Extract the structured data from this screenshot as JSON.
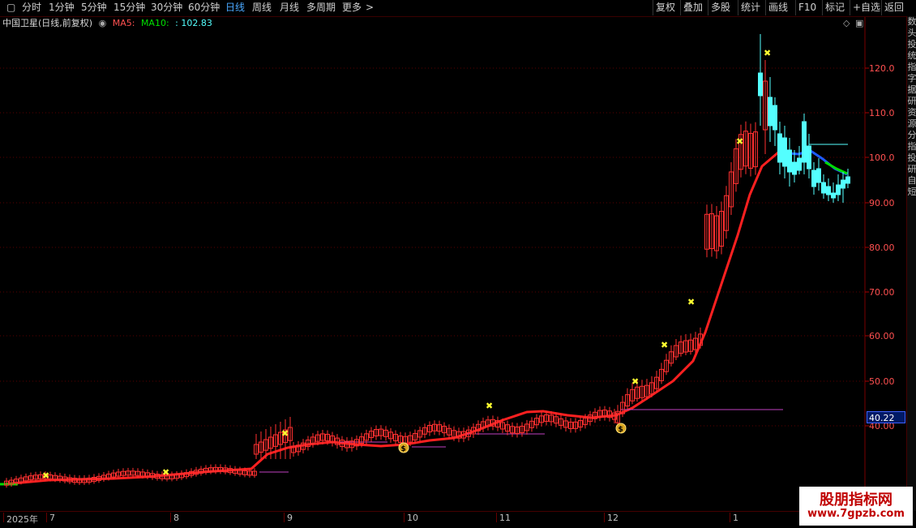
{
  "toolbar": {
    "left": [
      {
        "id": "fenshi",
        "label": "分时"
      },
      {
        "id": "1min",
        "label": "1分钟"
      },
      {
        "id": "5min",
        "label": "5分钟"
      },
      {
        "id": "15min",
        "label": "15分钟"
      },
      {
        "id": "30min",
        "label": "30分钟"
      },
      {
        "id": "60min",
        "label": "60分钟"
      },
      {
        "id": "day",
        "label": "日线",
        "active": true
      },
      {
        "id": "week",
        "label": "周线"
      },
      {
        "id": "month",
        "label": "月线"
      },
      {
        "id": "multi",
        "label": "多周期"
      },
      {
        "id": "more",
        "label": "更多"
      }
    ],
    "right": [
      {
        "id": "fuquan",
        "label": "复权"
      },
      {
        "id": "diejia",
        "label": "叠加"
      },
      {
        "id": "duogu",
        "label": "多股"
      },
      {
        "id": "tongji",
        "label": "统计"
      },
      {
        "id": "huaxian",
        "label": "画线"
      },
      {
        "id": "f10",
        "label": "F10"
      },
      {
        "id": "biaoji",
        "label": "标记"
      },
      {
        "id": "zixuan",
        "label": "+自选"
      },
      {
        "id": "fanhui",
        "label": "返回"
      }
    ]
  },
  "title": {
    "stock": "中国卫星(日线,前复权)",
    "ma5_label": "MA5:",
    "ma10_label": "MA10:",
    "ma10_value": ": 102.83"
  },
  "axis": {
    "y_ticks": [
      "120.0",
      "110.0",
      "100.0",
      "90.00",
      "80.00",
      "70.00",
      "60.00",
      "50.00",
      "40.00"
    ],
    "x_labels": [
      "2025年",
      "7",
      "8",
      "9",
      "10",
      "11",
      "12",
      "1"
    ],
    "current_price": "40.22"
  },
  "side_strip": [
    "数",
    "头",
    "投",
    "统",
    "指",
    "字",
    "据",
    "研",
    "资",
    "源",
    "分",
    "指",
    "投",
    "研",
    "自",
    "短"
  ],
  "watermark": {
    "name": "股朋指标网",
    "url": "www.7gpzb.com"
  },
  "colors": {
    "up": "#ff3030",
    "down": "#54ffff",
    "ma_red": "#ff2020",
    "ma_blue": "#1e5bff",
    "ma_green": "#00dd00",
    "grid": "#5a0000",
    "line_purple": "#c040c0"
  },
  "chart_data": {
    "type": "candlestick",
    "ylim": [
      30,
      128
    ],
    "key_prices": {
      "start_low": 28,
      "peak_high": 127.5,
      "last_close": 95
    }
  }
}
